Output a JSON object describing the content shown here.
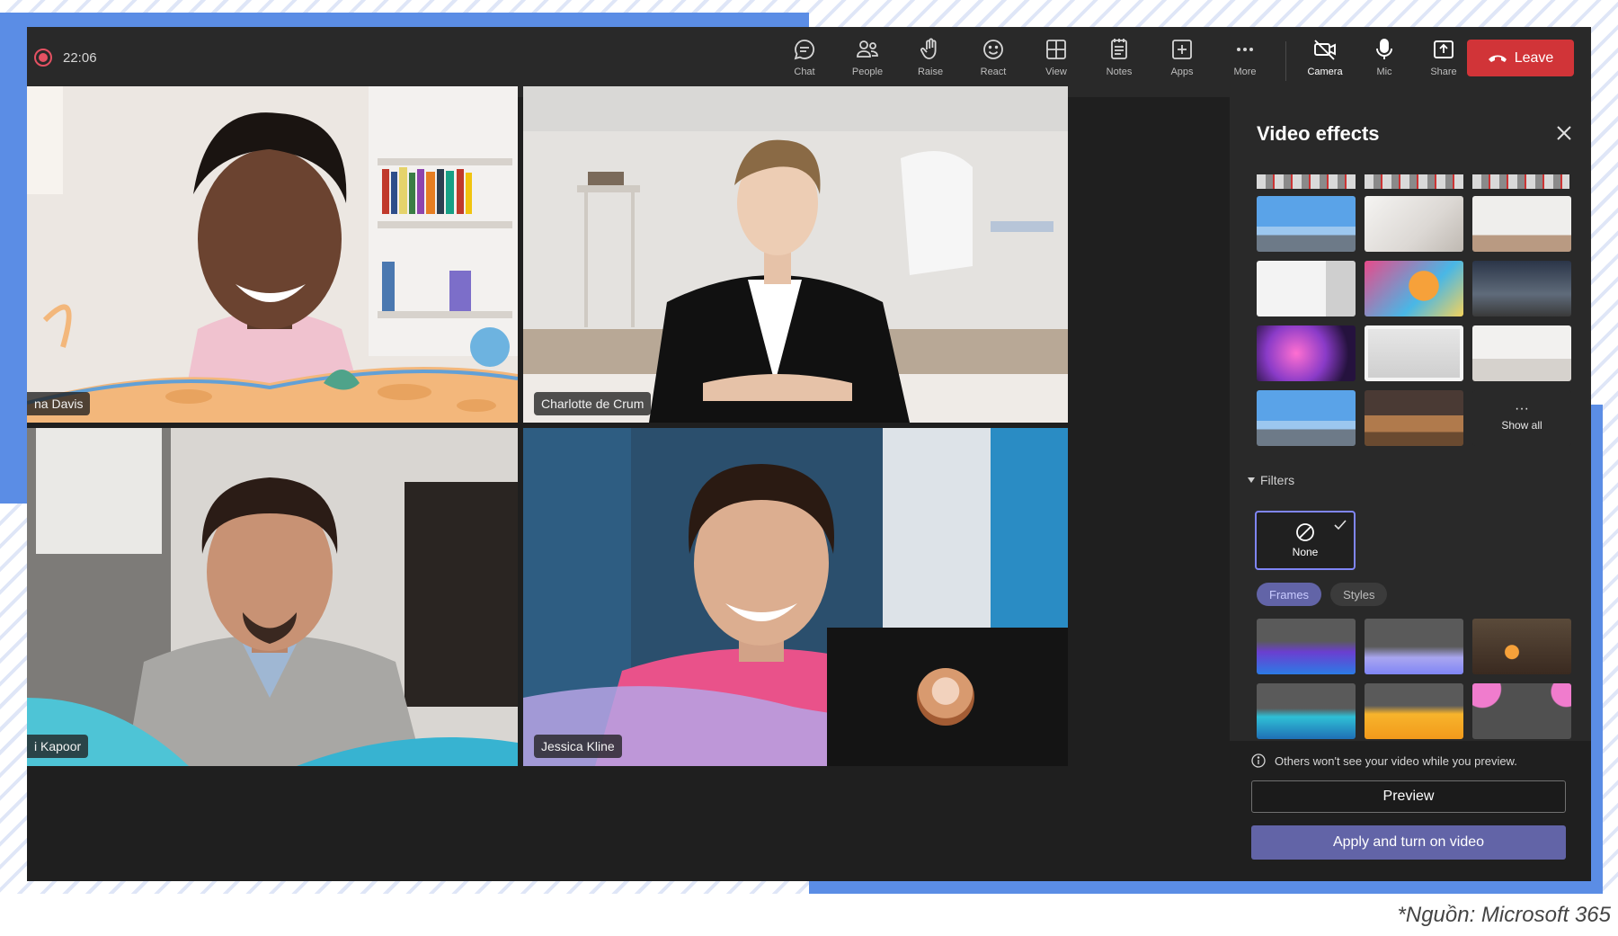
{
  "meeting": {
    "timer": "22:06",
    "colors": {
      "accent": "#6264a7",
      "leave": "#d13438",
      "record": "#e45162",
      "frame": "#5b8de5"
    }
  },
  "toolbar": {
    "items": [
      {
        "label": "Chat",
        "icon": "chat-icon"
      },
      {
        "label": "People",
        "icon": "people-icon"
      },
      {
        "label": "Raise",
        "icon": "raise-hand-icon"
      },
      {
        "label": "React",
        "icon": "smiley-icon"
      },
      {
        "label": "View",
        "icon": "grid-view-icon"
      },
      {
        "label": "Notes",
        "icon": "notes-icon"
      },
      {
        "label": "Apps",
        "icon": "apps-plus-icon"
      },
      {
        "label": "More",
        "icon": "more-dots-icon"
      }
    ],
    "media": [
      {
        "label": "Camera",
        "icon": "camera-off-icon"
      },
      {
        "label": "Mic",
        "icon": "mic-icon"
      },
      {
        "label": "Share",
        "icon": "share-icon"
      }
    ],
    "leave_label": "Leave"
  },
  "participants": {
    "top_left": "na Davis",
    "top_right": "Charlotte de Crum",
    "bottom_left": "i Kapoor",
    "bottom_right": "Jessica Kline"
  },
  "panel": {
    "title": "Video effects",
    "show_all": "Show all",
    "filters_label": "Filters",
    "none_label": "None",
    "tabs": [
      "Frames",
      "Styles"
    ],
    "preview_notice": "Others won't see your video while you preview.",
    "preview_label": "Preview",
    "apply_label": "Apply and turn on video"
  },
  "source_credit": "*Nguồn: Microsoft 365"
}
